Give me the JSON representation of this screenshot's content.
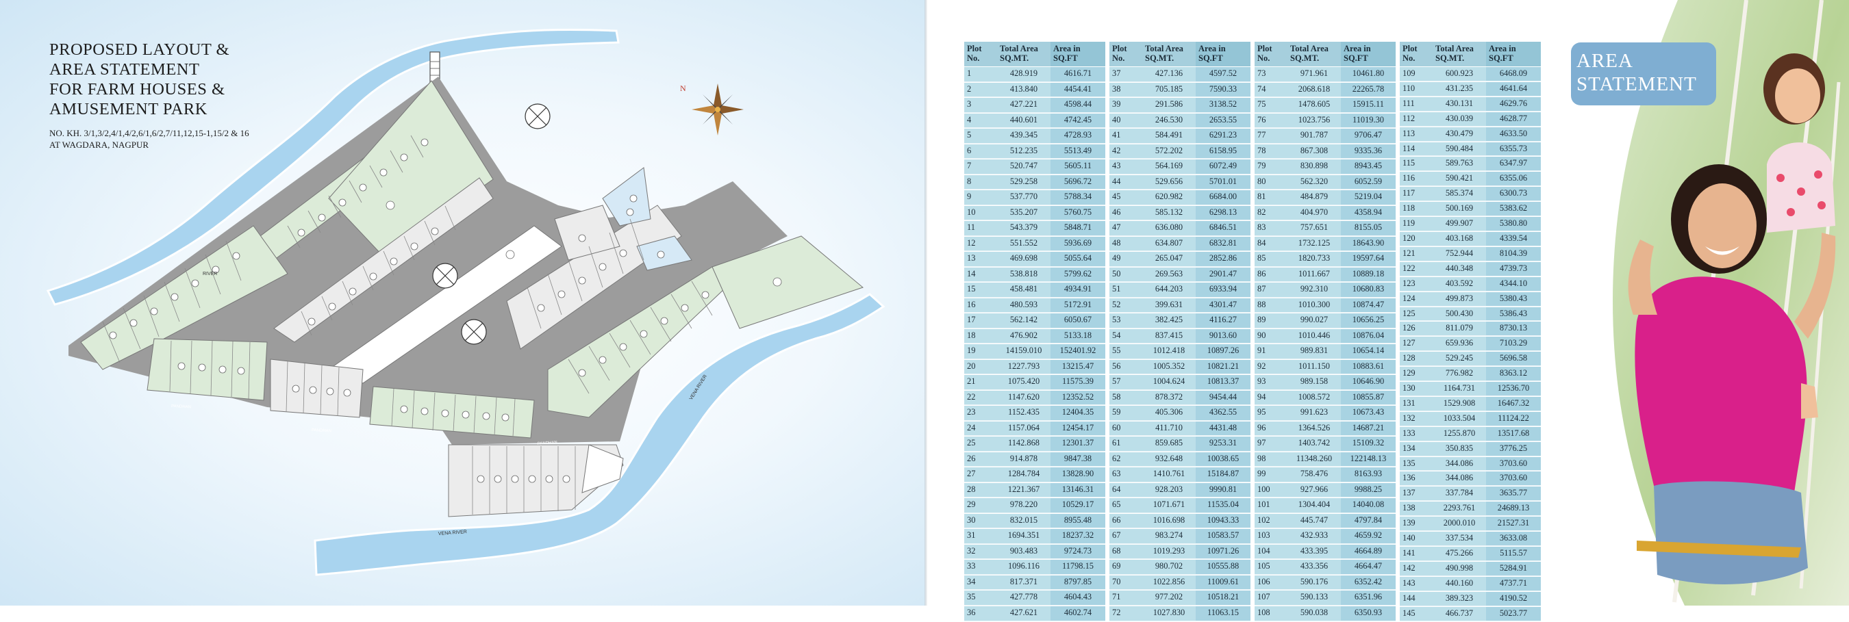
{
  "map_page": {
    "title_lines": [
      "PROPOSED LAYOUT &",
      "AREA STATEMENT",
      "FOR FARM HOUSES &",
      "AMUSEMENT PARK"
    ],
    "survey_numbers": "NO. KH. 3/1,3/2,4/1,4/2,6/1,6/2,7/11,12,15-1,15/2 & 16",
    "location": "AT WAGDARA, NAGPUR",
    "compass_label": "N",
    "labels": {
      "river_upper": "RIVER",
      "vena_river_right": "VENA RIVER",
      "vena_river_bottom": "VENA RIVER",
      "road_1": "PANDHAN",
      "road_2": "PANDHAN",
      "road_3": "PANDHAN"
    }
  },
  "area_statement": {
    "badge_lines": [
      "AREA",
      "STATEMENT"
    ],
    "headers": {
      "plot": [
        "Plot",
        "No."
      ],
      "total_area": [
        "Total Area",
        "SQ.MT."
      ],
      "area_in": [
        "Area in",
        "SQ.FT"
      ]
    },
    "columns": [
      [
        [
          "1",
          "428.919",
          "4616.71"
        ],
        [
          "2",
          "413.840",
          "4454.41"
        ],
        [
          "3",
          "427.221",
          "4598.44"
        ],
        [
          "4",
          "440.601",
          "4742.45"
        ],
        [
          "5",
          "439.345",
          "4728.93"
        ],
        [
          "6",
          "512.235",
          "5513.49"
        ],
        [
          "7",
          "520.747",
          "5605.11"
        ],
        [
          "8",
          "529.258",
          "5696.72"
        ],
        [
          "9",
          "537.770",
          "5788.34"
        ],
        [
          "10",
          "535.207",
          "5760.75"
        ],
        [
          "11",
          "543.379",
          "5848.71"
        ],
        [
          "12",
          "551.552",
          "5936.69"
        ],
        [
          "13",
          "469.698",
          "5055.64"
        ],
        [
          "14",
          "538.818",
          "5799.62"
        ],
        [
          "15",
          "458.481",
          "4934.91"
        ],
        [
          "16",
          "480.593",
          "5172.91"
        ],
        [
          "17",
          "562.142",
          "6050.67"
        ],
        [
          "18",
          "476.902",
          "5133.18"
        ],
        [
          "19",
          "14159.010",
          "152401.92"
        ],
        [
          "20",
          "1227.793",
          "13215.47"
        ],
        [
          "21",
          "1075.420",
          "11575.39"
        ],
        [
          "22",
          "1147.620",
          "12352.52"
        ],
        [
          "23",
          "1152.435",
          "12404.35"
        ],
        [
          "24",
          "1157.064",
          "12454.17"
        ],
        [
          "25",
          "1142.868",
          "12301.37"
        ],
        [
          "26",
          "914.878",
          "9847.38"
        ],
        [
          "27",
          "1284.784",
          "13828.90"
        ],
        [
          "28",
          "1221.367",
          "13146.31"
        ],
        [
          "29",
          "978.220",
          "10529.17"
        ],
        [
          "30",
          "832.015",
          "8955.48"
        ],
        [
          "31",
          "1694.351",
          "18237.32"
        ],
        [
          "32",
          "903.483",
          "9724.73"
        ],
        [
          "33",
          "1096.116",
          "11798.15"
        ],
        [
          "34",
          "817.371",
          "8797.85"
        ],
        [
          "35",
          "427.778",
          "4604.43"
        ],
        [
          "36",
          "427.621",
          "4602.74"
        ]
      ],
      [
        [
          "37",
          "427.136",
          "4597.52"
        ],
        [
          "38",
          "705.185",
          "7590.33"
        ],
        [
          "39",
          "291.586",
          "3138.52"
        ],
        [
          "40",
          "246.530",
          "2653.55"
        ],
        [
          "41",
          "584.491",
          "6291.23"
        ],
        [
          "42",
          "572.202",
          "6158.95"
        ],
        [
          "43",
          "564.169",
          "6072.49"
        ],
        [
          "44",
          "529.656",
          "5701.01"
        ],
        [
          "45",
          "620.982",
          "6684.00"
        ],
        [
          "46",
          "585.132",
          "6298.13"
        ],
        [
          "47",
          "636.080",
          "6846.51"
        ],
        [
          "48",
          "634.807",
          "6832.81"
        ],
        [
          "49",
          "265.047",
          "2852.86"
        ],
        [
          "50",
          "269.563",
          "2901.47"
        ],
        [
          "51",
          "644.203",
          "6933.94"
        ],
        [
          "52",
          "399.631",
          "4301.47"
        ],
        [
          "53",
          "382.425",
          "4116.27"
        ],
        [
          "54",
          "837.415",
          "9013.60"
        ],
        [
          "55",
          "1012.418",
          "10897.26"
        ],
        [
          "56",
          "1005.352",
          "10821.21"
        ],
        [
          "57",
          "1004.624",
          "10813.37"
        ],
        [
          "58",
          "878.372",
          "9454.44"
        ],
        [
          "59",
          "405.306",
          "4362.55"
        ],
        [
          "60",
          "411.710",
          "4431.48"
        ],
        [
          "61",
          "859.685",
          "9253.31"
        ],
        [
          "62",
          "932.648",
          "10038.65"
        ],
        [
          "63",
          "1410.761",
          "15184.87"
        ],
        [
          "64",
          "928.203",
          "9990.81"
        ],
        [
          "65",
          "1071.671",
          "11535.04"
        ],
        [
          "66",
          "1016.698",
          "10943.33"
        ],
        [
          "67",
          "983.274",
          "10583.57"
        ],
        [
          "68",
          "1019.293",
          "10971.26"
        ],
        [
          "69",
          "980.702",
          "10555.88"
        ],
        [
          "70",
          "1022.856",
          "11009.61"
        ],
        [
          "71",
          "977.202",
          "10518.21"
        ],
        [
          "72",
          "1027.830",
          "11063.15"
        ]
      ],
      [
        [
          "73",
          "971.961",
          "10461.80"
        ],
        [
          "74",
          "2068.618",
          "22265.78"
        ],
        [
          "75",
          "1478.605",
          "15915.11"
        ],
        [
          "76",
          "1023.756",
          "11019.30"
        ],
        [
          "77",
          "901.787",
          "9706.47"
        ],
        [
          "78",
          "867.308",
          "9335.36"
        ],
        [
          "79",
          "830.898",
          "8943.45"
        ],
        [
          "80",
          "562.320",
          "6052.59"
        ],
        [
          "81",
          "484.879",
          "5219.04"
        ],
        [
          "82",
          "404.970",
          "4358.94"
        ],
        [
          "83",
          "757.651",
          "8155.05"
        ],
        [
          "84",
          "1732.125",
          "18643.90"
        ],
        [
          "85",
          "1820.733",
          "19597.64"
        ],
        [
          "86",
          "1011.667",
          "10889.18"
        ],
        [
          "87",
          "992.310",
          "10680.83"
        ],
        [
          "88",
          "1010.300",
          "10874.47"
        ],
        [
          "89",
          "990.027",
          "10656.25"
        ],
        [
          "90",
          "1010.446",
          "10876.04"
        ],
        [
          "91",
          "989.831",
          "10654.14"
        ],
        [
          "92",
          "1011.150",
          "10883.61"
        ],
        [
          "93",
          "989.158",
          "10646.90"
        ],
        [
          "94",
          "1008.572",
          "10855.87"
        ],
        [
          "95",
          "991.623",
          "10673.43"
        ],
        [
          "96",
          "1364.526",
          "14687.21"
        ],
        [
          "97",
          "1403.742",
          "15109.32"
        ],
        [
          "98",
          "11348.260",
          "122148.13"
        ],
        [
          "99",
          "758.476",
          "8163.93"
        ],
        [
          "100",
          "927.966",
          "9988.25"
        ],
        [
          "101",
          "1304.404",
          "14040.08"
        ],
        [
          "102",
          "445.747",
          "4797.84"
        ],
        [
          "103",
          "432.933",
          "4659.92"
        ],
        [
          "104",
          "433.395",
          "4664.89"
        ],
        [
          "105",
          "433.356",
          "4664.47"
        ],
        [
          "106",
          "590.176",
          "6352.42"
        ],
        [
          "107",
          "590.133",
          "6351.96"
        ],
        [
          "108",
          "590.038",
          "6350.93"
        ]
      ],
      [
        [
          "109",
          "600.923",
          "6468.09"
        ],
        [
          "110",
          "431.235",
          "4641.64"
        ],
        [
          "111",
          "430.131",
          "4629.76"
        ],
        [
          "112",
          "430.039",
          "4628.77"
        ],
        [
          "113",
          "430.479",
          "4633.50"
        ],
        [
          "114",
          "590.484",
          "6355.73"
        ],
        [
          "115",
          "589.763",
          "6347.97"
        ],
        [
          "116",
          "590.421",
          "6355.06"
        ],
        [
          "117",
          "585.374",
          "6300.73"
        ],
        [
          "118",
          "500.169",
          "5383.62"
        ],
        [
          "119",
          "499.907",
          "5380.80"
        ],
        [
          "120",
          "403.168",
          "4339.54"
        ],
        [
          "121",
          "752.944",
          "8104.39"
        ],
        [
          "122",
          "440.348",
          "4739.73"
        ],
        [
          "123",
          "403.592",
          "4344.10"
        ],
        [
          "124",
          "499.873",
          "5380.43"
        ],
        [
          "125",
          "500.430",
          "5386.43"
        ],
        [
          "126",
          "811.079",
          "8730.13"
        ],
        [
          "127",
          "659.936",
          "7103.29"
        ],
        [
          "128",
          "529.245",
          "5696.58"
        ],
        [
          "129",
          "776.982",
          "8363.12"
        ],
        [
          "130",
          "1164.731",
          "12536.70"
        ],
        [
          "131",
          "1529.908",
          "16467.32"
        ],
        [
          "132",
          "1033.504",
          "11124.22"
        ],
        [
          "133",
          "1255.870",
          "13517.68"
        ],
        [
          "134",
          "350.835",
          "3776.25"
        ],
        [
          "135",
          "344.086",
          "3703.60"
        ],
        [
          "136",
          "344.086",
          "3703.60"
        ],
        [
          "137",
          "337.784",
          "3635.77"
        ],
        [
          "138",
          "2293.761",
          "24689.13"
        ],
        [
          "139",
          "2000.010",
          "21527.31"
        ],
        [
          "140",
          "337.534",
          "3633.08"
        ],
        [
          "141",
          "475.266",
          "5115.57"
        ],
        [
          "142",
          "490.998",
          "5284.91"
        ],
        [
          "143",
          "440.160",
          "4737.71"
        ],
        [
          "144",
          "389.323",
          "4190.52"
        ],
        [
          "145",
          "466.737",
          "5023.77"
        ]
      ]
    ]
  },
  "colors": {
    "plot_green": "#dcebd8",
    "plot_grey": "#ececec",
    "plot_blue": "#d6e9f6",
    "road": "#9c9c9c",
    "river": "#a9d4ef",
    "table_cell": "#bcdfe9",
    "table_header": "#a6cfdd",
    "badge": "#7faed2",
    "dress_pink": "#d9208a"
  }
}
